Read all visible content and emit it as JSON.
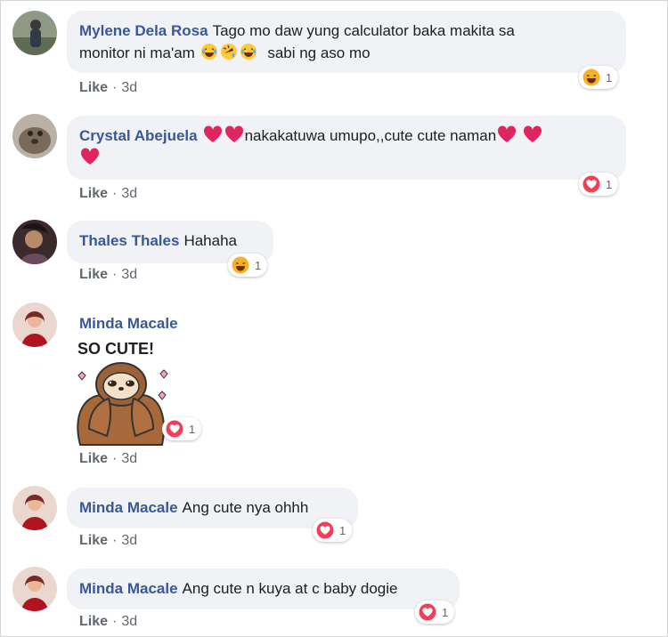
{
  "comments": [
    {
      "author": "Mylene Dela Rosa",
      "text_1": "Tago mo daw yung calculator baka makita sa",
      "text_2": "monitor ni ma'am",
      "text_3": "sabi ng aso mo",
      "like": "Like",
      "time": "3d",
      "reaction_type": "haha",
      "reaction_count": "1"
    },
    {
      "author": "Crystal Abejuela",
      "text": "nakakatuwa umupo,,cute cute naman",
      "like": "Like",
      "time": "3d",
      "reaction_type": "love",
      "reaction_count": "1"
    },
    {
      "author": "Thales Thales",
      "text": "Hahaha",
      "like": "Like",
      "time": "3d",
      "reaction_type": "haha",
      "reaction_count": "1"
    },
    {
      "author": "Minda Macale",
      "sticker_text": "SO CUTE!",
      "like": "Like",
      "time": "3d",
      "reaction_type": "love",
      "reaction_count": "1"
    },
    {
      "author": "Minda Macale",
      "text": "Ang cute nya ohhh",
      "like": "Like",
      "time": "3d",
      "reaction_type": "love",
      "reaction_count": "1"
    },
    {
      "author": "Minda Macale",
      "text": "Ang cute n kuya at c baby dogie",
      "like": "Like",
      "time": "3d",
      "reaction_type": "love",
      "reaction_count": "1"
    }
  ],
  "separator": "·",
  "colors": {
    "author": "#385898",
    "bubble": "#f0f2f5",
    "meta": "#606770",
    "love": "#f33e58",
    "haha": "#f7b125",
    "heart_emoji": "#e0245e"
  }
}
